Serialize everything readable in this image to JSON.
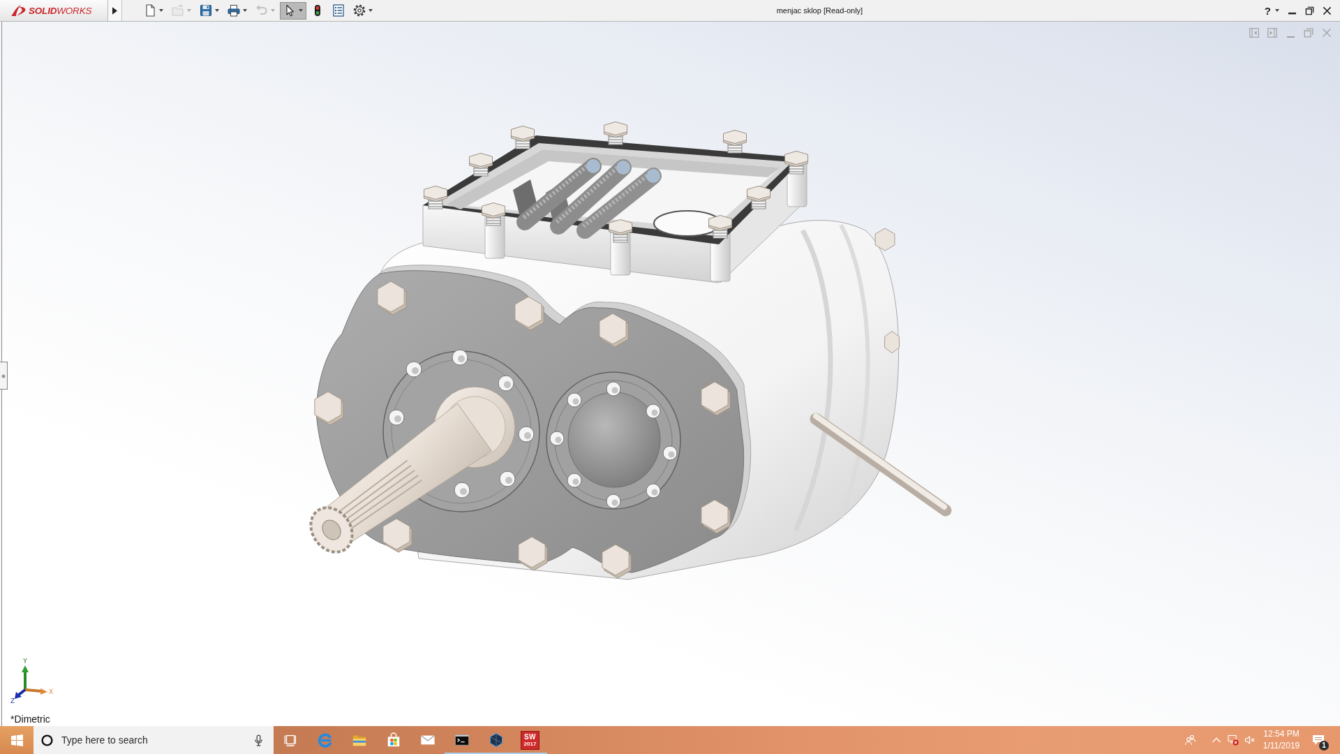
{
  "window": {
    "logo": "**SOLID**WORKS",
    "title": "menjac sklop [Read-only]",
    "controls": [
      {
        "kind": "help",
        "label": "?",
        "dropdown": true
      },
      {
        "kind": "minimize"
      },
      {
        "kind": "restore"
      },
      {
        "kind": "close"
      }
    ]
  },
  "toolbar": {
    "items": [
      {
        "kind": "new",
        "dropdown": true,
        "disabled": false,
        "selected": false
      },
      {
        "kind": "open",
        "dropdown": true,
        "disabled": true,
        "selected": false
      },
      {
        "kind": "save",
        "dropdown": true,
        "disabled": false,
        "selected": false
      },
      {
        "kind": "print",
        "dropdown": true,
        "disabled": false,
        "selected": false
      },
      {
        "kind": "undo",
        "dropdown": true,
        "disabled": true,
        "selected": false
      },
      {
        "kind": "select",
        "dropdown": true,
        "disabled": false,
        "selected": true
      },
      {
        "kind": "rebuild",
        "dropdown": false,
        "disabled": false,
        "selected": false
      },
      {
        "kind": "properties",
        "dropdown": false,
        "disabled": false,
        "selected": false
      },
      {
        "kind": "options",
        "dropdown": true,
        "disabled": false,
        "selected": false
      }
    ]
  },
  "viewport": {
    "controls": [
      {
        "kind": "split-left"
      },
      {
        "kind": "split-right"
      },
      {
        "kind": "minimize"
      },
      {
        "kind": "restore"
      },
      {
        "kind": "close"
      }
    ],
    "triad": {
      "x": "X",
      "y": "Y",
      "z": "Z"
    },
    "view_name": "*Dimetric"
  },
  "taskbar": {
    "search": {
      "placeholder": "Type here to search"
    },
    "apps": [
      {
        "kind": "task-view",
        "running": false
      },
      {
        "kind": "edge",
        "running": false
      },
      {
        "kind": "file-explorer",
        "running": false
      },
      {
        "kind": "store",
        "running": false
      },
      {
        "kind": "mail",
        "running": false
      },
      {
        "kind": "terminal",
        "running": true
      },
      {
        "kind": "hex-app",
        "running": true
      },
      {
        "kind": "solidworks",
        "label": "SW",
        "sublabel": "2017",
        "running": true
      }
    ],
    "tray": [
      {
        "kind": "people"
      },
      {
        "kind": "chevron"
      },
      {
        "kind": "network-error"
      },
      {
        "kind": "volume-muted"
      }
    ],
    "clock": {
      "time": "12:54 PM",
      "date": "1/11/2019"
    },
    "notifications": {
      "count": "1"
    }
  }
}
